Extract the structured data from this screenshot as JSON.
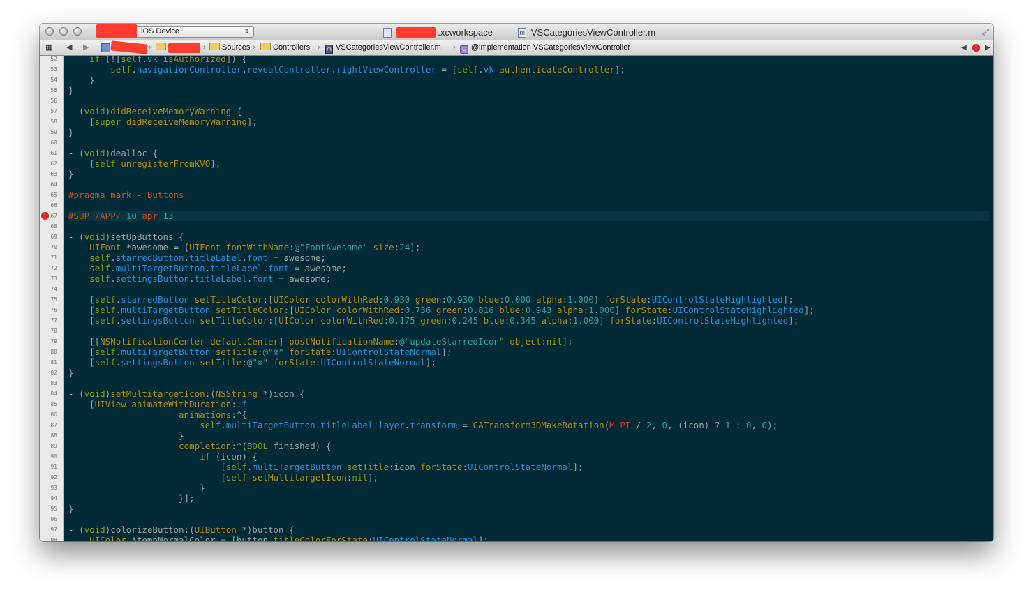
{
  "window": {
    "title_workspace": ".xcworkspace",
    "title_separator": "—",
    "title_file": "VSCategoriesViewController.m",
    "scheme_destination": "iOS Device",
    "scheme_arrows": "⇕"
  },
  "jump_bar": {
    "crumbs": [
      "Sources",
      "Controllers",
      "VSCategoriesViewController.m",
      "@implementation VSCategoriesViewController"
    ],
    "file_icon_letter": "m",
    "class_icon_letter": "C",
    "error_badge": "!"
  },
  "icons": {
    "grid": "grid-icon",
    "back": "back-arrow-icon",
    "forward": "forward-arrow-icon",
    "error": "error-icon",
    "fullscreen": "fullscreen-icon"
  },
  "colors": {
    "editor_background": "#002b36",
    "keyword": "#859900",
    "type": "#b58900",
    "property": "#268bd2",
    "number_string": "#2aa198",
    "preprocessor": "#cb4b16",
    "error": "#dc322f"
  },
  "editor": {
    "error_line": 67,
    "current_line": 67,
    "lines": [
      {
        "n": 52,
        "text": "    if (![self.vk isAuthorized]) {"
      },
      {
        "n": 53,
        "text": "        self.navigationController.revealController.rightViewController = [self.vk authenticateController];"
      },
      {
        "n": 54,
        "text": "    }"
      },
      {
        "n": 55,
        "text": "}"
      },
      {
        "n": 56,
        "text": ""
      },
      {
        "n": 57,
        "text": "- (void)didReceiveMemoryWarning {"
      },
      {
        "n": 58,
        "text": "    [super didReceiveMemoryWarning];"
      },
      {
        "n": 59,
        "text": "}"
      },
      {
        "n": 60,
        "text": ""
      },
      {
        "n": 61,
        "text": "- (void)dealloc {"
      },
      {
        "n": 62,
        "text": "    [self unregisterFromKVO];"
      },
      {
        "n": 63,
        "text": "}"
      },
      {
        "n": 64,
        "text": ""
      },
      {
        "n": 65,
        "text": "#pragma mark - Buttons"
      },
      {
        "n": 66,
        "text": ""
      },
      {
        "n": 67,
        "text": "#SUP /APP/ 10 apr 13"
      },
      {
        "n": 68,
        "text": ""
      },
      {
        "n": 69,
        "text": "- (void)setUpButtons {"
      },
      {
        "n": 70,
        "text": "    UIFont *awesome = [UIFont fontWithName:@\"FontAwesome\" size:24];"
      },
      {
        "n": 71,
        "text": "    self.starredButton.titleLabel.font = awesome;"
      },
      {
        "n": 72,
        "text": "    self.multiTargetButton.titleLabel.font = awesome;"
      },
      {
        "n": 73,
        "text": "    self.settingsButton.titleLabel.font = awesome;"
      },
      {
        "n": 74,
        "text": ""
      },
      {
        "n": 75,
        "text": "    [self.starredButton setTitleColor:[UIColor colorWithRed:0.930 green:0.930 blue:0.000 alpha:1.000] forState:UIControlStateHighlighted];"
      },
      {
        "n": 76,
        "text": "    [self.multiTargetButton setTitleColor:[UIColor colorWithRed:0.736 green:0.816 blue:0.943 alpha:1.000] forState:UIControlStateHighlighted];"
      },
      {
        "n": 77,
        "text": "    [self.settingsButton setTitleColor:[UIColor colorWithRed:0.175 green:0.245 blue:0.345 alpha:1.000] forState:UIControlStateHighlighted];"
      },
      {
        "n": 78,
        "text": ""
      },
      {
        "n": 79,
        "text": "    [[NSNotificationCenter defaultCenter] postNotificationName:@\"updateStarredIcon\" object:nil];"
      },
      {
        "n": 80,
        "text": "    [self.multiTargetButton setTitle:@\"⊠\" forState:UIControlStateNormal];"
      },
      {
        "n": 81,
        "text": "    [self.settingsButton setTitle:@\"⊠\" forState:UIControlStateNormal];"
      },
      {
        "n": 82,
        "text": "}"
      },
      {
        "n": 83,
        "text": ""
      },
      {
        "n": 84,
        "text": "- (void)setMultitargetIcon:(NSString *)icon {"
      },
      {
        "n": 85,
        "text": "    [UIView animateWithDuration:.2f"
      },
      {
        "n": 86,
        "text": "                     animations:^{"
      },
      {
        "n": 87,
        "text": "                         self.multiTargetButton.titleLabel.layer.transform = CATransform3DMakeRotation(M_PI / 2, 0, (icon) ? 1 : 0, 0);"
      },
      {
        "n": 88,
        "text": "                     }"
      },
      {
        "n": 89,
        "text": "                     completion:^(BOOL finished) {"
      },
      {
        "n": 90,
        "text": "                         if (icon) {"
      },
      {
        "n": 91,
        "text": "                             [self.multiTargetButton setTitle:icon forState:UIControlStateNormal];"
      },
      {
        "n": 92,
        "text": "                             [self setMultitargetIcon:nil];"
      },
      {
        "n": 93,
        "text": "                         }"
      },
      {
        "n": 94,
        "text": "                     }];"
      },
      {
        "n": 95,
        "text": "}"
      },
      {
        "n": 96,
        "text": ""
      },
      {
        "n": 97,
        "text": "- (void)colorizeButton:(UIButton *)button {"
      },
      {
        "n": 98,
        "text": "    UIColor *tempNormalColor = [button titleColorForState:UIControlStateNormal];"
      }
    ]
  }
}
